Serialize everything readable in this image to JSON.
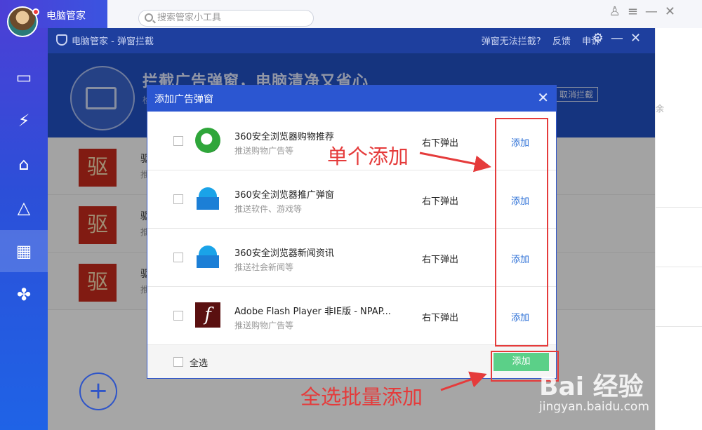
{
  "app": {
    "brand_name": "电脑管家",
    "search_placeholder": "搜索管家小工具"
  },
  "window": {
    "title": "电脑管家 - 弹窗拦截",
    "links": [
      "弹窗无法拦截?",
      "反馈",
      "申诉"
    ],
    "banner_title": "拦截广告弹窗，电脑清净又省心",
    "banner_sub": "检",
    "cancel_label": "取消拦截",
    "bg_rows": [
      {
        "badge": "驱",
        "name": "驱",
        "desc": "推"
      },
      {
        "badge": "驱",
        "name": "驱",
        "desc": "推"
      },
      {
        "badge": "驱",
        "name": "驱",
        "desc": "推"
      }
    ],
    "right_text": "余",
    "plus": "+"
  },
  "dialog": {
    "title": "添加广告弹窗",
    "close": "✕",
    "items": [
      {
        "name": "360安全浏览器购物推荐",
        "desc": "推送购物广告等",
        "position": "右下弹出",
        "add": "添加",
        "icon": "ie-icon"
      },
      {
        "name": "360安全浏览器推广弹窗",
        "desc": "推送软件、游戏等",
        "position": "右下弹出",
        "add": "添加",
        "icon": "bag-icon"
      },
      {
        "name": "360安全浏览器新闻资讯",
        "desc": "推送社会新闻等",
        "position": "右下弹出",
        "add": "添加",
        "icon": "bag-icon"
      },
      {
        "name": "Adobe Flash Player 非IE版 - NPAP...",
        "desc": "推送购物广告等",
        "position": "右下弹出",
        "add": "添加",
        "icon": "flash-icon"
      }
    ],
    "select_all": "全选",
    "add_button": "添加"
  },
  "annotations": {
    "single_add": "单个添加",
    "batch_add": "全选批量添加",
    "color": "#e53b3b"
  },
  "watermark": {
    "brand": "Bai 经验",
    "url": "jingyan.baidu.com"
  }
}
